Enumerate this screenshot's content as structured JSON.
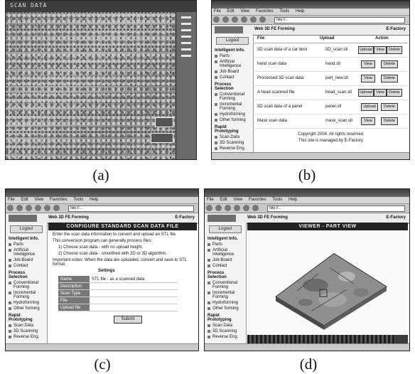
{
  "captions": [
    "(a)",
    "(b)",
    "(c)",
    "(d)"
  ],
  "panel_a": {
    "title": "SCAN DATA"
  },
  "browser": {
    "menu": [
      "File",
      "Edit",
      "View",
      "Favorites",
      "Tools",
      "Help"
    ],
    "address": "http://...",
    "site_title": "Web 3D FE Forming",
    "brand": "E-Factory",
    "sidebar": {
      "login_button": "Logout",
      "sections": [
        {
          "title": "Intelligent Info.",
          "items": [
            "Parts",
            "Artificial Intelligence",
            "Job Board",
            "Contact"
          ]
        },
        {
          "title": "Process Selection",
          "items": [
            "Conventional Forming",
            "Incremental Forming",
            "Hydroforming",
            "Other forming"
          ]
        },
        {
          "title": "Rapid Prototyping",
          "items": [
            "Scan Data",
            "3D Scanning",
            "Reverse Eng."
          ]
        }
      ]
    }
  },
  "panel_b": {
    "headers": [
      "File",
      "Upload",
      "Action"
    ],
    "rows": [
      {
        "name": "3D scan data of a car door",
        "file": "3D_scan.stl",
        "buttons": [
          "Upload",
          "View",
          "Delete"
        ]
      },
      {
        "name": "hand scan data",
        "file": "hand.stl",
        "buttons": [
          "View",
          "Delete"
        ]
      },
      {
        "name": "Processed 3D scan data",
        "file": "part_new.stl",
        "buttons": [
          "View",
          "Delete"
        ]
      },
      {
        "name": "A head scanned file",
        "file": "head_scan.stl",
        "buttons": [
          "Upload",
          "View",
          "Delete"
        ]
      },
      {
        "name": "3D scan data of a panel",
        "file": "panel.stl",
        "buttons": [
          "Upload",
          "Delete"
        ]
      },
      {
        "name": "Mask scan data",
        "file": "mask_scan.stl",
        "buttons": [
          "View",
          "Delete"
        ]
      }
    ],
    "footnote_1": "Copyright 2004. All rights reserved.",
    "footnote_2": "This site is managed by E-Factory."
  },
  "panel_c": {
    "band_title": "CONFIGURE STANDARD SCAN DATA FILE",
    "intro": "Enter the scan data information to convert and upload an STL file.",
    "steps_intro": "This conversion program can generally process files:",
    "step_1": "1) Choose scan data - with no upload height.",
    "step_2": "2) Choose scan data - smoothed with 2D or 3D algorithm.",
    "notes": "Important notes: When the data are uploaded, convert and save to STL format.",
    "form_title": "Settings",
    "fields": [
      {
        "label": "Name",
        "value": "STL file - as a scanned data"
      },
      {
        "label": "Description",
        "value": ""
      },
      {
        "label": "Scan Type",
        "value": ""
      },
      {
        "label": "File",
        "value": ""
      },
      {
        "label": "Upload file",
        "value": ""
      }
    ],
    "submit": "Submit"
  },
  "panel_d": {
    "band_title": "VIEWER - PART VIEW",
    "progress": 0.92
  }
}
